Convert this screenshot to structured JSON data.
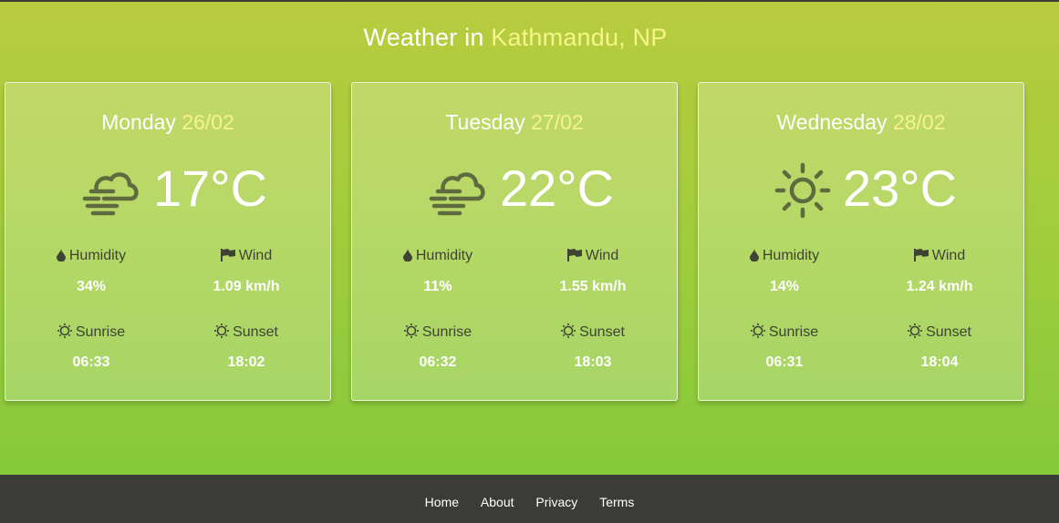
{
  "header": {
    "title_prefix": "Weather in",
    "city": "Kathmandu, NP"
  },
  "colors": {
    "accent": "#f6f48a",
    "icon": "#5f6b3e",
    "footer_bg": "#3b3b38"
  },
  "forecast": [
    {
      "day": "Monday",
      "date": "26/02",
      "icon": "cloud-fog-icon",
      "temperature": "17°C",
      "humidity_label": "Humidity",
      "humidity": "34%",
      "wind_label": "Wind",
      "wind": "1.09 km/h",
      "sunrise_label": "Sunrise",
      "sunrise": "06:33",
      "sunset_label": "Sunset",
      "sunset": "18:02"
    },
    {
      "day": "Tuesday",
      "date": "27/02",
      "icon": "cloud-fog-icon",
      "temperature": "22°C",
      "humidity_label": "Humidity",
      "humidity": "11%",
      "wind_label": "Wind",
      "wind": "1.55 km/h",
      "sunrise_label": "Sunrise",
      "sunrise": "06:32",
      "sunset_label": "Sunset",
      "sunset": "18:03"
    },
    {
      "day": "Wednesday",
      "date": "28/02",
      "icon": "sun-icon",
      "temperature": "23°C",
      "humidity_label": "Humidity",
      "humidity": "14%",
      "wind_label": "Wind",
      "wind": "1.24 km/h",
      "sunrise_label": "Sunrise",
      "sunrise": "06:31",
      "sunset_label": "Sunset",
      "sunset": "18:04"
    }
  ],
  "footer": {
    "links": [
      "Home",
      "About",
      "Privacy",
      "Terms"
    ]
  }
}
